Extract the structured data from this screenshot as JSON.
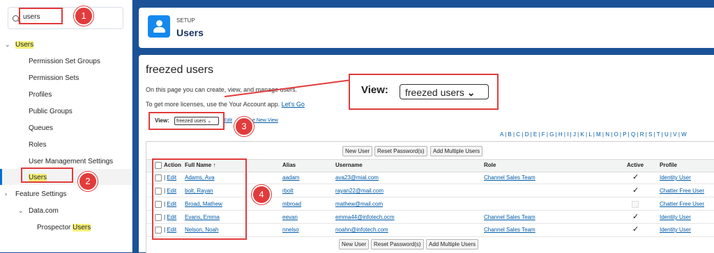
{
  "sidebar": {
    "search_value": "users",
    "items": [
      {
        "label": "Users"
      },
      {
        "label": "Permission Set Groups"
      },
      {
        "label": "Permission Sets"
      },
      {
        "label": "Profiles"
      },
      {
        "label": "Public Groups"
      },
      {
        "label": "Queues"
      },
      {
        "label": "Roles"
      },
      {
        "label": "User Management Settings"
      },
      {
        "label": "Users"
      },
      {
        "label": "Feature Settings"
      },
      {
        "label": "Data.com"
      },
      {
        "label": "Prospector ",
        "highlight": "Users"
      }
    ]
  },
  "header": {
    "breadcrumb": "SETUP",
    "title": "Users"
  },
  "main": {
    "title": "freezed users",
    "intro": "On this page you can create, view, and manage users.",
    "license_text": "To get more licenses, use the Your Account app.",
    "license_link": "Let's Go",
    "view_label": "View:",
    "view_value": "freezed users",
    "edit_link": "Edit",
    "create_view_link": "e New View",
    "alpha": "A | B | C | D | E | F | G | H | I | J | K | L | M | N | O | P | Q | R | S | T | U | V | W",
    "buttons": {
      "new_user": "New User",
      "reset_password": "Reset Password(s)",
      "add_multiple": "Add Multiple Users"
    },
    "columns": {
      "action": "Action",
      "full_name": "Full Name ↑",
      "alias": "Alias",
      "username": "Username",
      "role": "Role",
      "active": "Active",
      "profile": "Profile"
    },
    "rows": [
      {
        "action": "Edit",
        "name": "Adams, Ava",
        "alias": "aadam",
        "username": "ava23@mial.com",
        "role": "Channel Sales Team",
        "active": true,
        "profile": "Identity User"
      },
      {
        "action": "Edit",
        "name": "bolt, Rayan",
        "alias": "rbolt",
        "username": "rayan22@mail.com",
        "role": "",
        "active": true,
        "profile": "Chatter Free User"
      },
      {
        "action": "Edit",
        "name": "Broad, Mathew",
        "alias": "mbroad",
        "username": "mathew@mail.com",
        "role": "",
        "active": false,
        "profile": "Chatter Free User"
      },
      {
        "action": "Edit",
        "name": "Evans, Emma",
        "alias": "eevan",
        "username": "emma44@infotech.ocm",
        "role": "Channel Sales Team",
        "active": true,
        "profile": "Identity User"
      },
      {
        "action": "Edit",
        "name": "Nelson, Noah",
        "alias": "nnelso",
        "username": "noahn@infotech.com",
        "role": "Channel Sales Team",
        "active": true,
        "profile": "Identity User"
      }
    ]
  },
  "callouts": {
    "zoom_view_label": "View:",
    "zoom_view_value": "freezed users",
    "badges": [
      "1",
      "2",
      "3",
      "4"
    ]
  },
  "colors": {
    "brand_bg": "#1b5297",
    "accent": "#0070d2",
    "callout": "#e23b3b",
    "highlight": "#f6f178"
  }
}
